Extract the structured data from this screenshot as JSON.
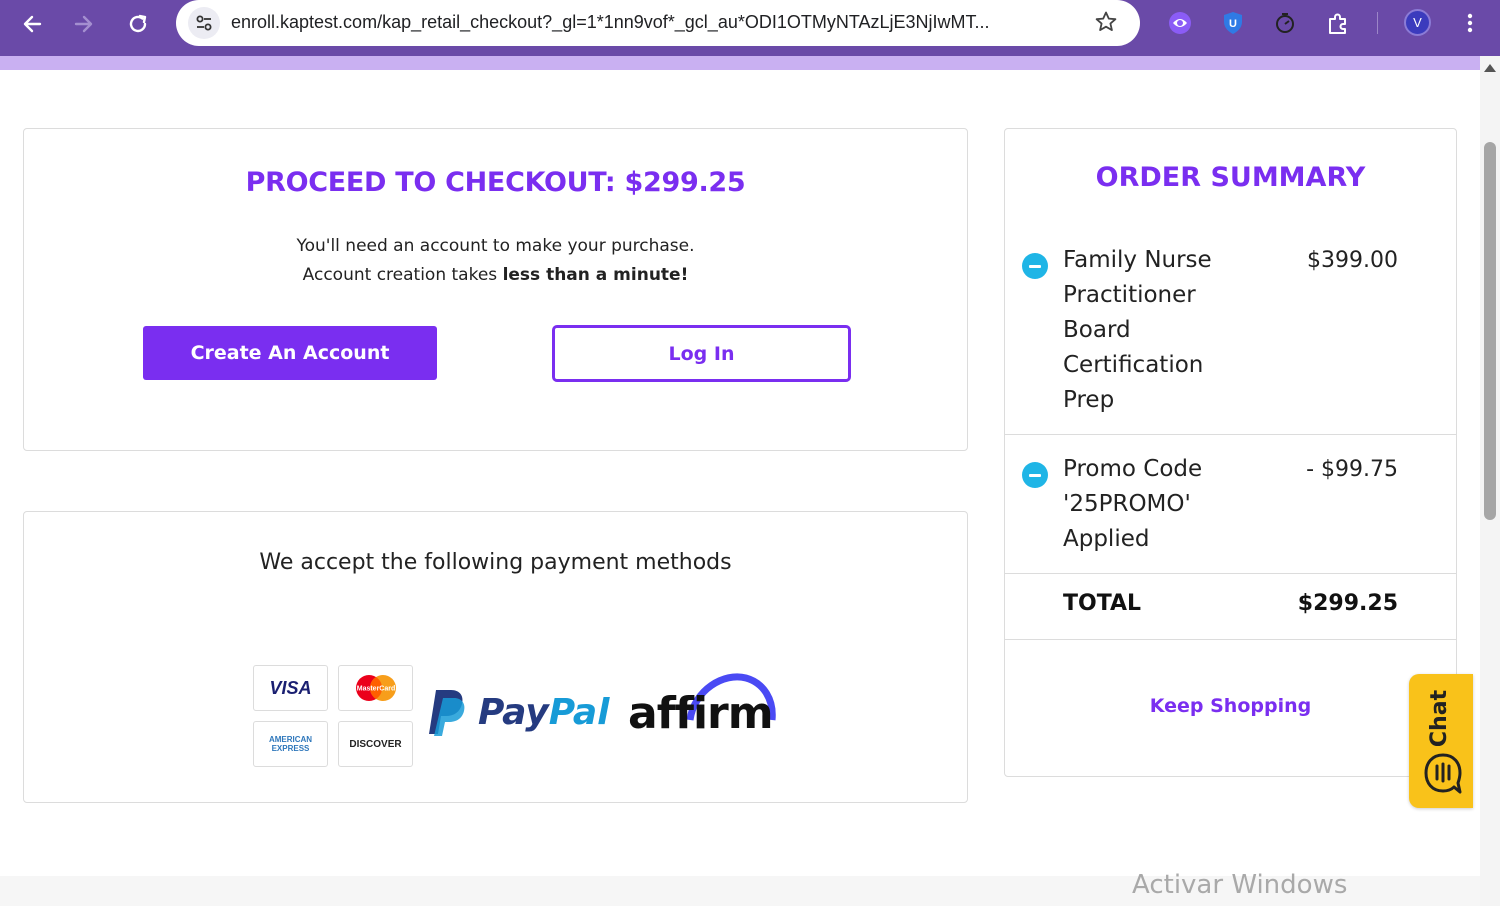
{
  "browser": {
    "url": "enroll.kaptest.com/kap_retail_checkout?_gl=1*1nn9vof*_gcl_au*ODI1OTMyNTAzLjE3NjIwMT...",
    "profile_initial": "V",
    "colors": {
      "toolbar": "#6a4aa8",
      "strip": "#c9b0f2"
    }
  },
  "checkout": {
    "title": "PROCEED TO CHECKOUT: $299.25",
    "line1": "You'll need an account to make your purchase.",
    "line2_prefix": "Account creation takes ",
    "line2_bold": "less than a minute!",
    "create_account_label": "Create An Account",
    "login_label": "Log In"
  },
  "payment": {
    "title": "We accept the following payment methods",
    "cards": [
      {
        "name": "visa",
        "label": "VISA"
      },
      {
        "name": "mastercard",
        "label": "MasterCard"
      },
      {
        "name": "amex",
        "label": "AMERICAN EXPRESS"
      },
      {
        "name": "discover",
        "label": "DISCOVER"
      }
    ],
    "paypal": {
      "pay": "Pay",
      "pal": "Pal"
    },
    "affirm": "affirm"
  },
  "summary": {
    "title": "ORDER SUMMARY",
    "items": [
      {
        "name": "Family Nurse Practitioner Board Certification Prep",
        "price": "$399.00"
      },
      {
        "name": "Promo Code '25PROMO' Applied",
        "price": "- $99.75"
      }
    ],
    "total_label": "TOTAL",
    "total_value": "$299.25",
    "keep_shopping": "Keep Shopping"
  },
  "chat": {
    "label": "Chat"
  },
  "watermark": "Activar Windows",
  "colors": {
    "accent": "#7a2ef0",
    "remove_icon": "#1fb5e6",
    "chat": "#f9c21a"
  }
}
